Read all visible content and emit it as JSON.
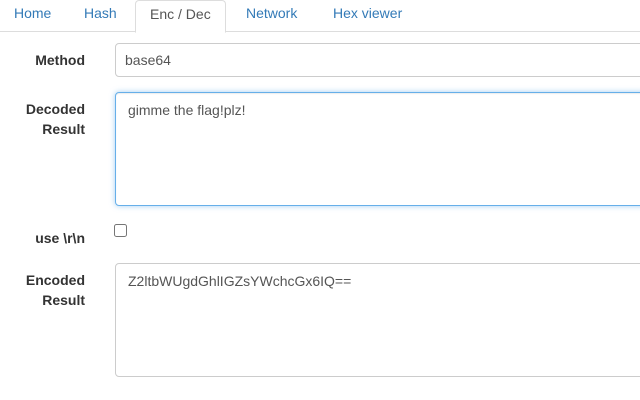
{
  "tabs": [
    {
      "label": "Home",
      "active": false
    },
    {
      "label": "Hash",
      "active": false
    },
    {
      "label": "Enc / Dec",
      "active": true
    },
    {
      "label": "Network",
      "active": false
    },
    {
      "label": "Hex viewer",
      "active": false
    }
  ],
  "colors": {
    "link": "#337ab7",
    "focus_border": "#66afe9"
  },
  "form": {
    "method": {
      "label": "Method",
      "value": "base64"
    },
    "decoded": {
      "label_line1": "Decoded",
      "label_line2": "Result",
      "value": "gimme the flag!plz!"
    },
    "crlf": {
      "label": "use \\r\\n",
      "checked": false
    },
    "encoded": {
      "label_line1": "Encoded",
      "label_line2": "Result",
      "value": "Z2ltbWUgdGhlIGZsYWchcGx6IQ=="
    }
  }
}
